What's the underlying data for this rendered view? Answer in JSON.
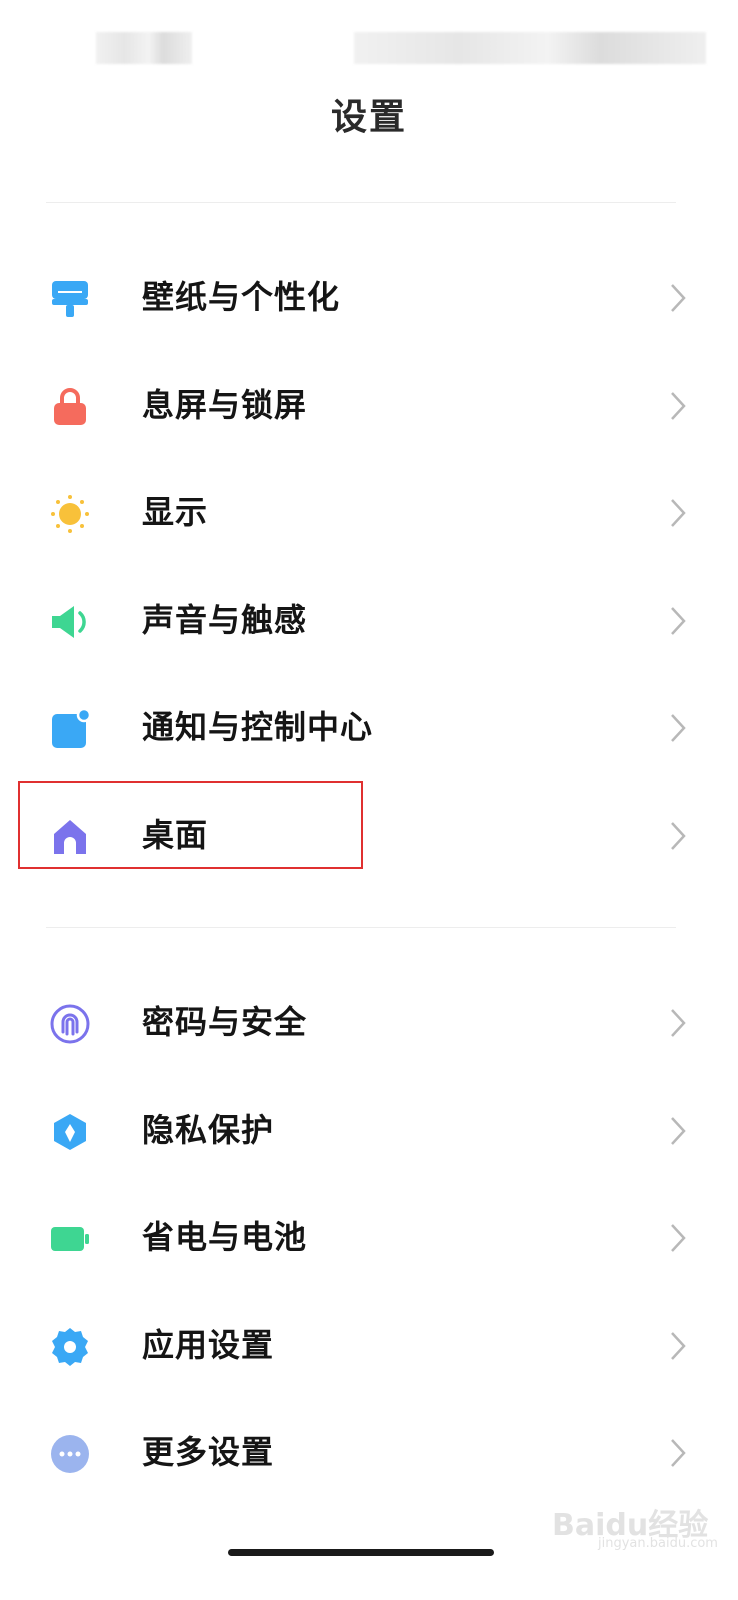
{
  "header": {
    "title": "设置"
  },
  "group1": [
    {
      "label": "壁纸与个性化",
      "icon": "wallpaper-brush-icon",
      "color": "#3aa8f5"
    },
    {
      "label": "息屏与锁屏",
      "icon": "lock-icon",
      "color": "#f56b5d"
    },
    {
      "label": "显示",
      "icon": "sun-icon",
      "color": "#f8c13a"
    },
    {
      "label": "声音与触感",
      "icon": "speaker-icon",
      "color": "#3ed692"
    },
    {
      "label": "通知与控制中心",
      "icon": "notification-icon",
      "color": "#3aa8f5"
    },
    {
      "label": "桌面",
      "icon": "home-icon",
      "color": "#7b73ec"
    }
  ],
  "group2": [
    {
      "label": "密码与安全",
      "icon": "fingerprint-icon",
      "color": "#7b73ec"
    },
    {
      "label": "隐私保护",
      "icon": "privacy-shield-icon",
      "color": "#3aa8f5"
    },
    {
      "label": "省电与电池",
      "icon": "battery-icon",
      "color": "#3ed692"
    },
    {
      "label": "应用设置",
      "icon": "gear-icon",
      "color": "#3aa8f5"
    },
    {
      "label": "更多设置",
      "icon": "more-icon",
      "color": "#9bb4ee"
    }
  ],
  "watermark": {
    "brand": "Baidu经验",
    "url": "jingyan.baidu.com"
  }
}
